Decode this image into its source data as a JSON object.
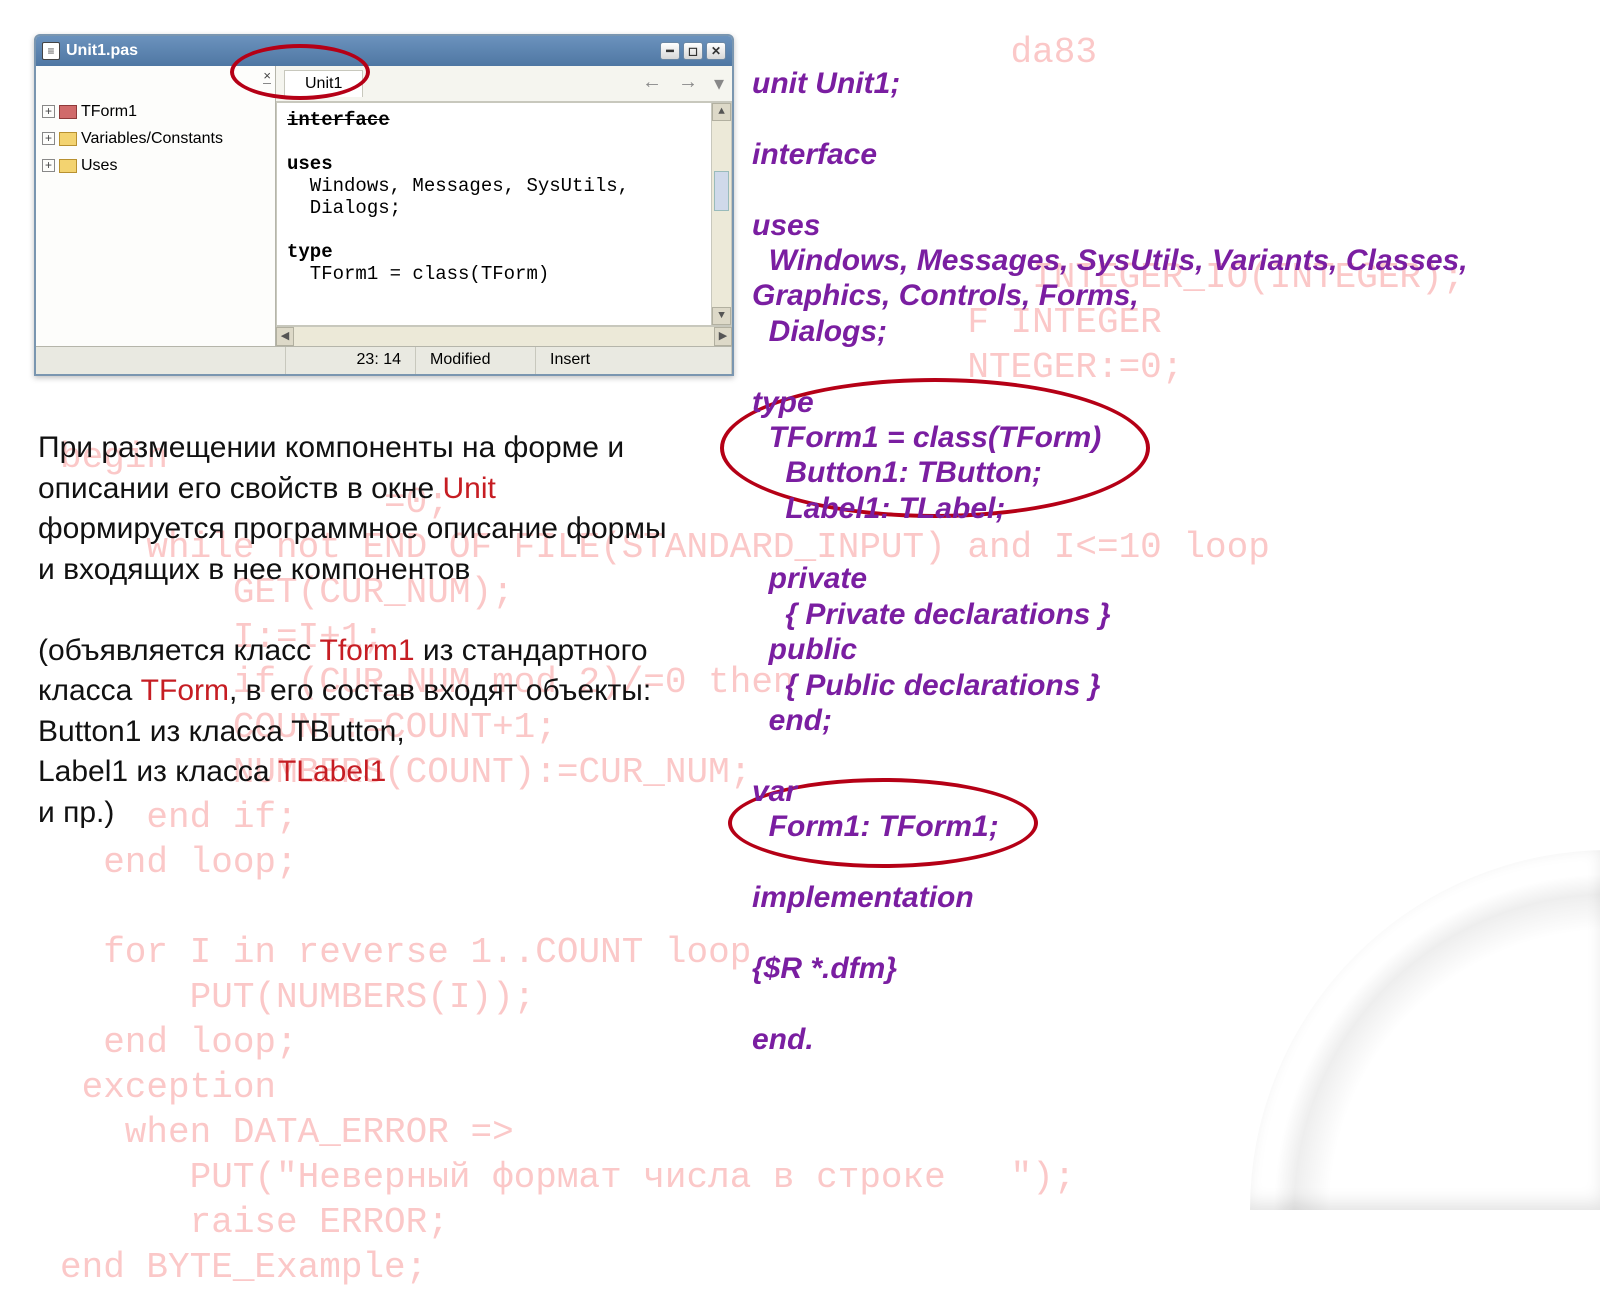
{
  "bg_code": "                                            da83\n\n\n\n\n                                             INTEGER_IO(INTEGER);\n                                          F INTEGER\n                                          NTEGER:=0;\n\nbegin\n               =0;\n    while not END OF FILE(STANDARD_INPUT) and I<=10 loop\n        GET(CUR_NUM);\n        I:=I+1;\n        if (CUR_NUM mod 2)/=0 then\n        COUNT:=COUNT+1;\n        NUMBERS(COUNT):=CUR_NUM;\n    end if;\n  end loop;\n\n  for I in reverse 1..COUNT loop\n      PUT(NUMBERS(I));\n  end loop;\n exception\n   when DATA_ERROR =>\n      PUT(\"Неверный формат числа в строке   \");\n      raise ERROR;\nend BYTE_Example;",
  "ide": {
    "title": "Unit1.pas",
    "tree": {
      "items": [
        {
          "label": "TForm1",
          "icon": "form"
        },
        {
          "label": "Variables/Constants",
          "icon": "folder"
        },
        {
          "label": "Uses",
          "icon": "folder"
        }
      ]
    },
    "tab": "Unit1",
    "code_kw_interface": "interface",
    "code_kw_uses": "uses",
    "code_line_uses_body": "  Windows, Messages, SysUtils,",
    "code_line_dialogs": "  Dialogs;",
    "code_kw_type": "type",
    "code_line_tform": "  TForm1 = class(TForm)",
    "status": {
      "pos": "23: 14",
      "modified": "Modified",
      "mode": "Insert"
    }
  },
  "desc": {
    "p1_a": "При размещении компоненты на форме и описании его свойств в окне ",
    "p1_unit": "Unit",
    "p1_b": " формируется программное описание формы и входящих в нее компонентов",
    "p2_a": "(объявляется класс ",
    "p2_tform1": "Tform1",
    "p2_b": " из стандартного класса ",
    "p2_tform": "TForm",
    "p2_c": ", в его состав входят объекты:",
    "p3": "Button1 из класса TButton,",
    "p4_a": "Label1 из класса ",
    "p4_tlabel": "TLabel1",
    "p5": "и пр.)"
  },
  "src": {
    "l1": "unit Unit1;",
    "l2": "interface",
    "l3": "uses",
    "l4": "  Windows, Messages, SysUtils, Variants, Classes, Graphics, Controls, Forms,",
    "l5": "  Dialogs;",
    "l6": "type",
    "l7": "  TForm1 = class(TForm)",
    "l8": "    Button1: TButton;",
    "l9": "    Label1: TLabel;",
    "l10": "  private",
    "l11": "    { Private declarations }",
    "l12": "  public",
    "l13": "    { Public declarations }",
    "l14": "  end;",
    "l15": "var",
    "l16": "  Form1: TForm1;",
    "l17": "implementation",
    "l18": "{$R *.dfm}",
    "l19": "end."
  }
}
